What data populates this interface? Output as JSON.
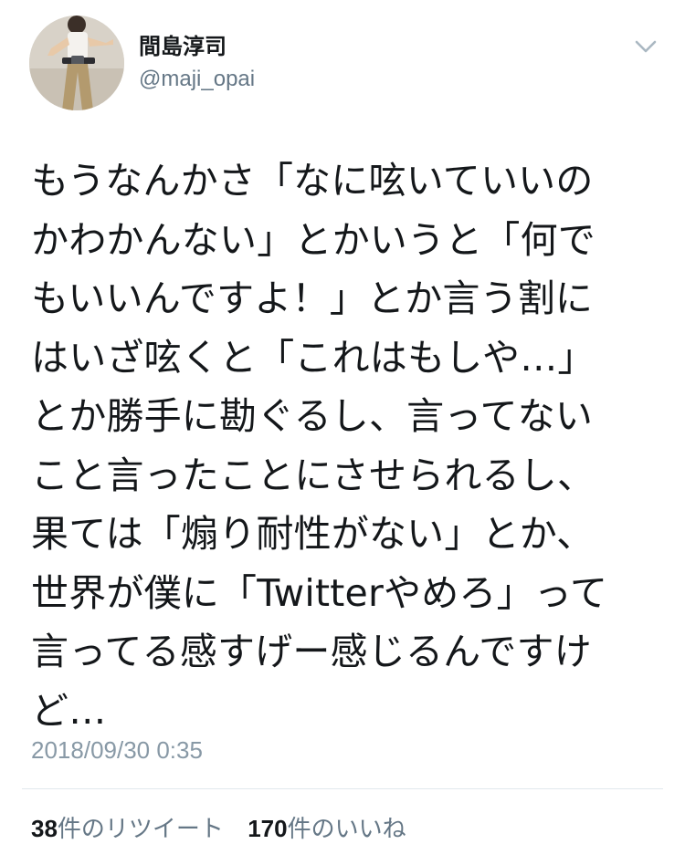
{
  "author": {
    "display_name": "間島淳司",
    "handle": "@maji_opai"
  },
  "tweet": {
    "lines": [
      "もうなんかさ「なに呟いていいの",
      "かわかんない」とかいうと「何で",
      "もいいんですよ！」とか言う割に",
      "はいざ呟くと「これはもしや…」",
      "とか勝手に勘ぐるし、言ってない",
      "こと言ったことにさせられるし、",
      "果ては「煽り耐性がない」とか、",
      "世界が僕に「Twitterやめろ」って",
      "言ってる感すげー感じるんですけ",
      "ど…"
    ],
    "timestamp": "2018/09/30 0:35"
  },
  "stats": {
    "retweets_count": "38",
    "retweets_label": "件のリツイート",
    "likes_count": "170",
    "likes_label": "件のいいね"
  },
  "icons": {
    "menu": "chevron-down-icon",
    "avatar": "profile-photo"
  },
  "colors": {
    "text": "#14171a",
    "secondary": "#657786",
    "timestamp": "#8899a6",
    "divider": "#e1e8ed"
  }
}
